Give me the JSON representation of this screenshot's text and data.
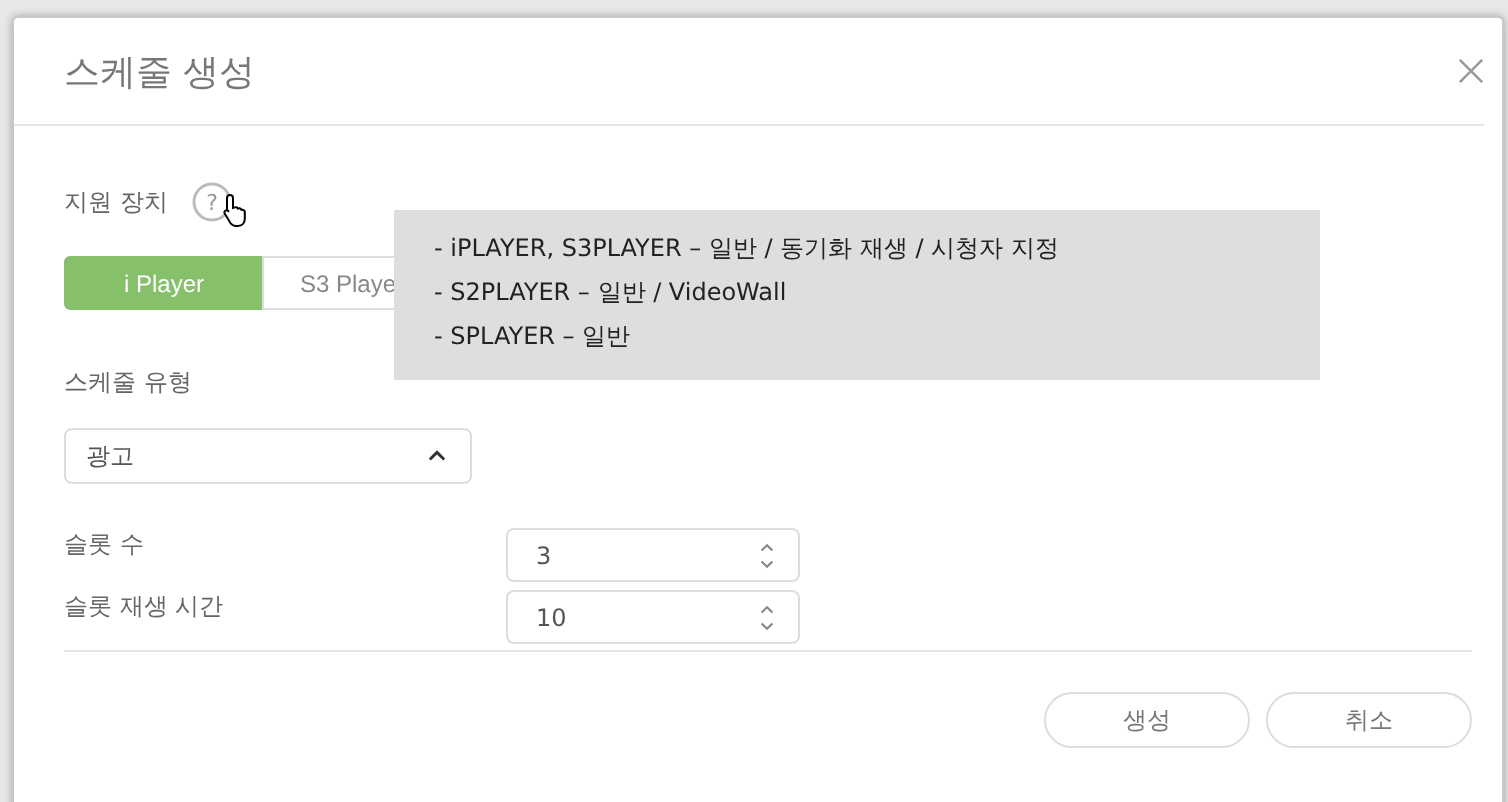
{
  "dialog": {
    "title": "스케줄 생성"
  },
  "devices": {
    "label": "지원 장치",
    "tabs": [
      {
        "label": "i Player",
        "selected": true
      },
      {
        "label": "S3 Playe",
        "selected": false
      }
    ],
    "help": "?"
  },
  "tooltip": {
    "lines": [
      "- iPLAYER, S3PLAYER – 일반 / 동기화 재생 / 시청자 지정",
      "- S2PLAYER – 일반 / VideoWall",
      "- SPLAYER – 일반"
    ]
  },
  "schedule_type": {
    "label": "스케줄 유형",
    "value": "광고",
    "expanded": true
  },
  "fields": [
    {
      "label": "슬롯 수",
      "value": "3"
    },
    {
      "label": "슬롯 재생 시간",
      "value": "10"
    }
  ],
  "buttons": [
    "생성",
    "취소"
  ]
}
